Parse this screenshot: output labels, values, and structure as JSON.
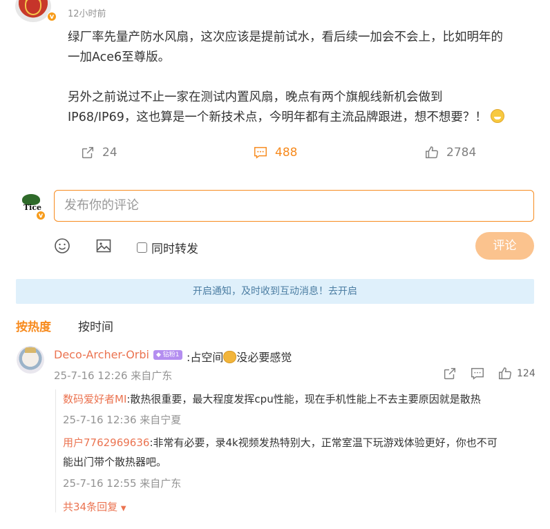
{
  "post": {
    "time": "12小时前",
    "body_lines": [
      "绿厂率先量产防水风扇，这次应该是提前试水，看后续一加会不会上，比如明年的",
      "一加Ace6至尊版。",
      "另外之前说过不止一家在测试内置风扇，晚点有两个旗舰线新机会做到",
      "IP68/IP69，这也算是一个新技术点，今明年都有主流品牌跟进，想不想要？！"
    ],
    "repost_count": "24",
    "comment_count": "488",
    "like_count": "2784",
    "verified_mark": "v"
  },
  "composer": {
    "placeholder": "发布你的评论",
    "repost_label": "同时转发",
    "submit_label": "评论",
    "avatar_text": "Tice"
  },
  "notify": {
    "text": "开启通知，及时收到互动消息！去开启"
  },
  "sort": {
    "hot": "按热度",
    "time": "按时间"
  },
  "comment": {
    "user": "Deco-Archer-Orbi",
    "badge": "钻粉1",
    "text_before": ":占空间",
    "text_after": "没必要感觉",
    "meta": "25-7-16 12:26 来自广东",
    "like_count": "124"
  },
  "replies": [
    {
      "user": "数码爱好者MI",
      "text": ":散热很重要，最大程度发挥cpu性能，现在手机性能上不去主要原因就是散热",
      "meta": "25-7-16 12:36 来自宁夏"
    },
    {
      "user": "用户7762969636",
      "text": ":非常有必要，录4k视频发热特别大，正常室温下玩游戏体验更好，你也不可",
      "text2": "能出门带个散热器吧。",
      "meta": "25-7-16 12:55 来自广东"
    }
  ],
  "more_replies": "共34条回复",
  "colors": {
    "accent": "#f78a1d",
    "username": "#eb7350",
    "notify_bg": "#dff0fb"
  }
}
